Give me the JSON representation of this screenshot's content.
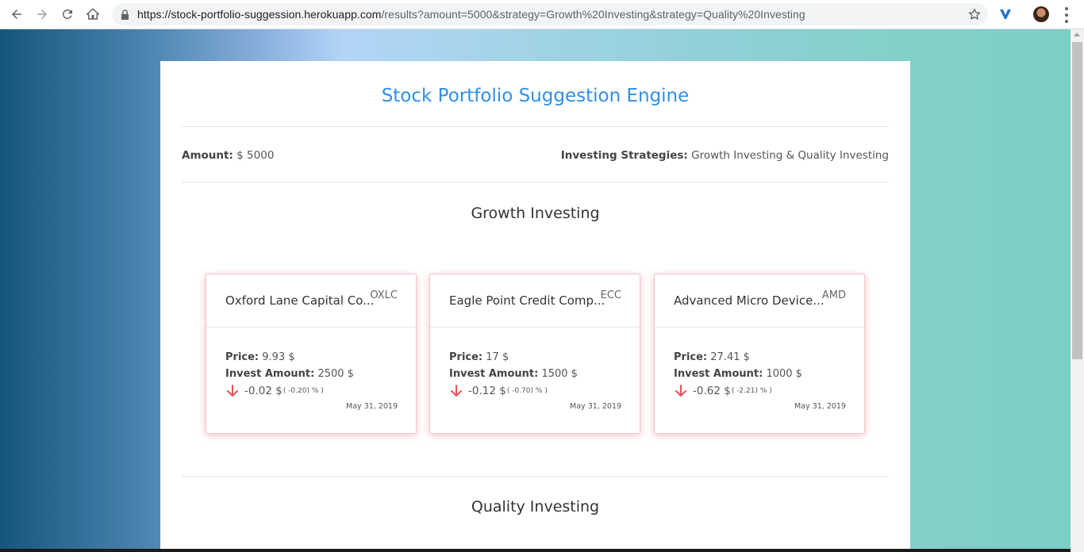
{
  "browser": {
    "url_host": "https://stock-portfolio-suggession.herokuapp.com",
    "url_path": "/results?amount=5000&strategy=Growth%20Investing&strategy=Quality%20Investing"
  },
  "page": {
    "title": "Stock Portfolio Suggestion Engine",
    "amount_label": "Amount:",
    "amount_value": "$ 5000",
    "strategies_label": "Investing Strategies:",
    "strategies_value": "Growth Investing & Quality Investing",
    "sections": [
      {
        "title": "Growth Investing",
        "cards": [
          {
            "name": "Oxford Lane Capital Co...",
            "ticker": "OXLC",
            "price_label": "Price:",
            "price": "9.93 $",
            "invest_label": "Invest Amount:",
            "invest": "2500 $",
            "change": "-0.02 $",
            "change_pct": "( -0.20) % )",
            "date": "May 31, 2019"
          },
          {
            "name": "Eagle Point Credit Comp...",
            "ticker": "ECC",
            "price_label": "Price:",
            "price": "17 $",
            "invest_label": "Invest Amount:",
            "invest": "1500 $",
            "change": "-0.12 $",
            "change_pct": "( -0.70) % )",
            "date": "May 31, 2019"
          },
          {
            "name": "Advanced Micro Device...",
            "ticker": "AMD",
            "price_label": "Price:",
            "price": "27.41 $",
            "invest_label": "Invest Amount:",
            "invest": "1000 $",
            "change": "-0.62 $",
            "change_pct": "( -2.21) % )",
            "date": "May 31, 2019"
          }
        ]
      },
      {
        "title": "Quality Investing"
      }
    ]
  },
  "colors": {
    "title": "#2f8fe6",
    "down_arrow": "#e8505b",
    "card_shadow": "#e65a69"
  }
}
